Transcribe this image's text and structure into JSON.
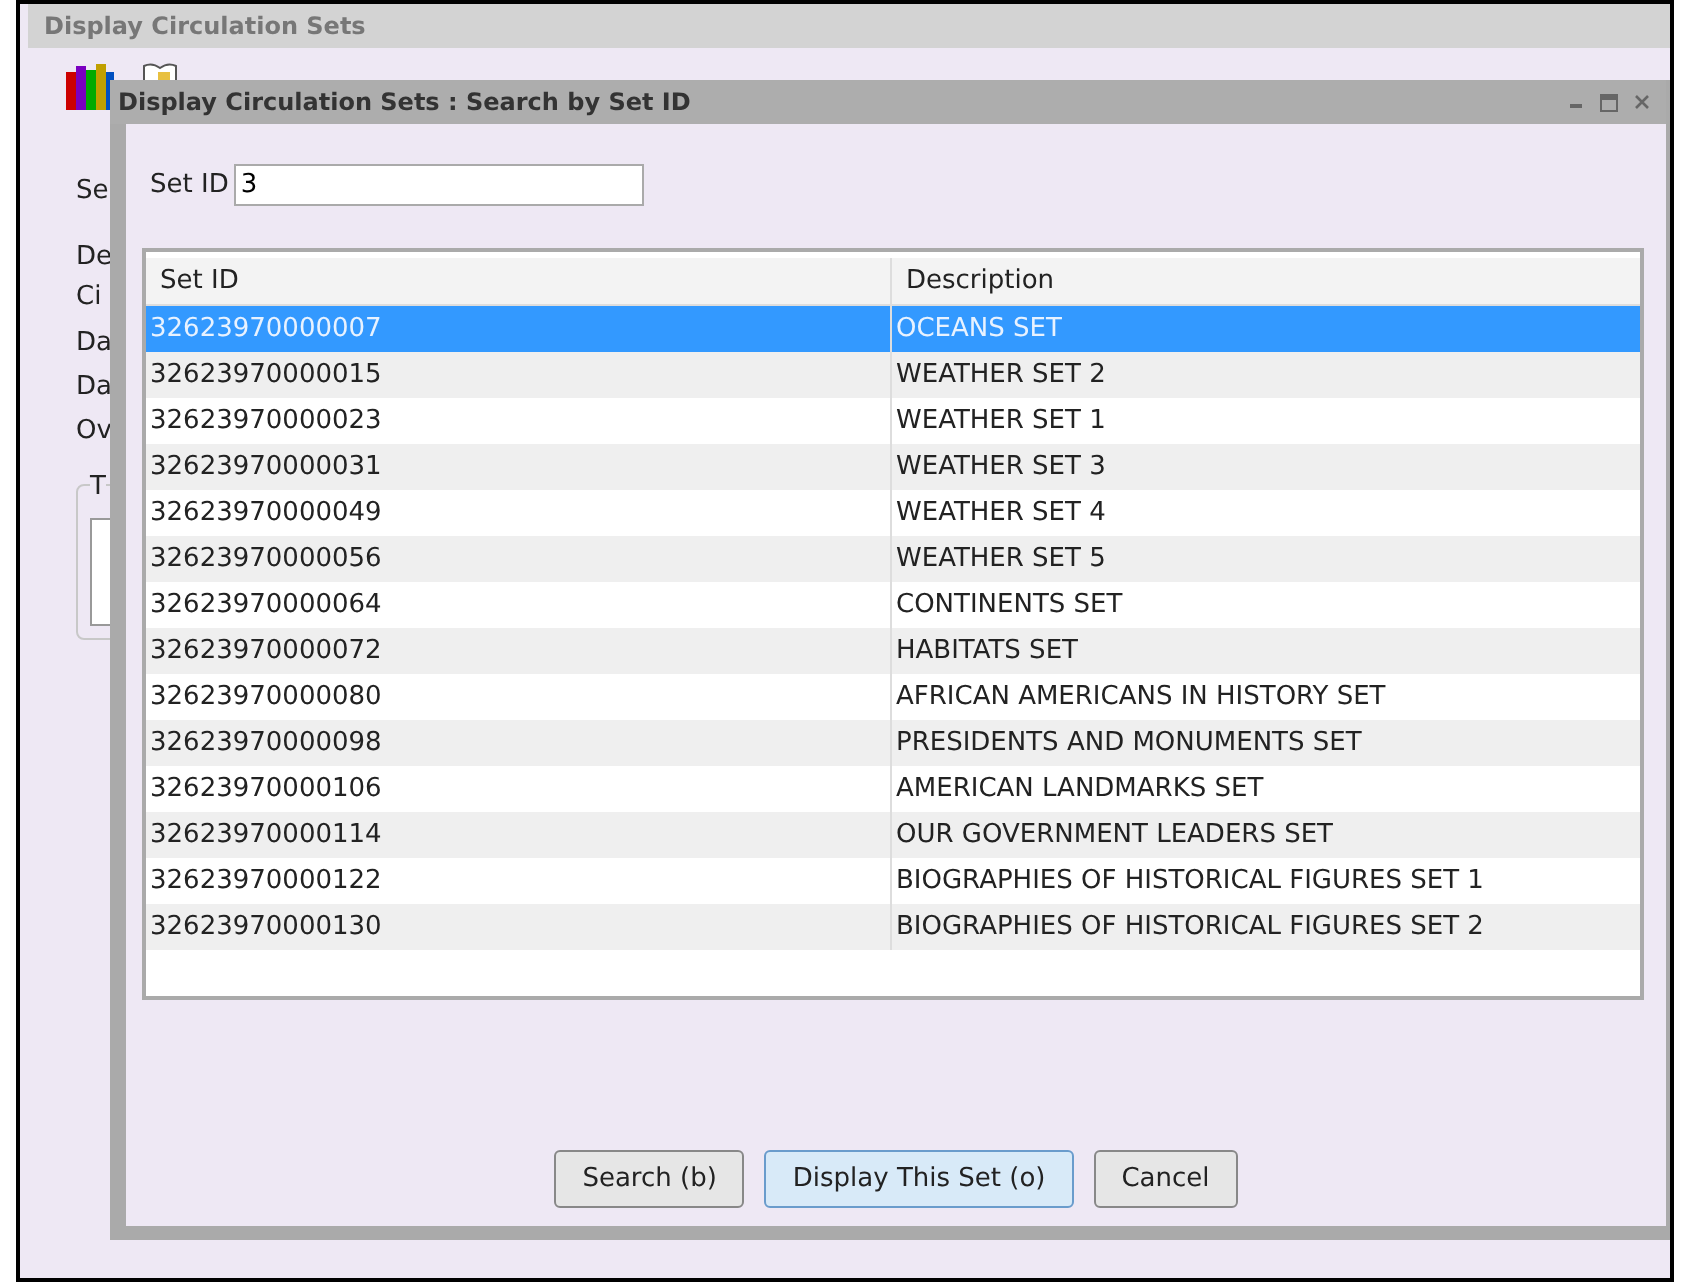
{
  "window": {
    "title": "Display Circulation Sets"
  },
  "background_labels": [
    "Se",
    "De",
    "Ci",
    "Da",
    "Da",
    "Ov"
  ],
  "background_group": {
    "label": "T"
  },
  "dialog": {
    "title": "Display Circulation Sets : Search by Set ID",
    "set_id_field": {
      "label": "Set ID",
      "value": "3"
    },
    "table": {
      "columns": [
        "Set ID",
        "Description"
      ],
      "rows": [
        {
          "set_id": "32623970000007",
          "description": "OCEANS SET",
          "selected": true
        },
        {
          "set_id": "32623970000015",
          "description": "WEATHER SET 2",
          "selected": false
        },
        {
          "set_id": "32623970000023",
          "description": "WEATHER SET 1",
          "selected": false
        },
        {
          "set_id": "32623970000031",
          "description": "WEATHER SET 3",
          "selected": false
        },
        {
          "set_id": "32623970000049",
          "description": "WEATHER SET 4",
          "selected": false
        },
        {
          "set_id": "32623970000056",
          "description": "WEATHER SET 5",
          "selected": false
        },
        {
          "set_id": "32623970000064",
          "description": "CONTINENTS SET",
          "selected": false
        },
        {
          "set_id": "32623970000072",
          "description": "HABITATS SET",
          "selected": false
        },
        {
          "set_id": "32623970000080",
          "description": "AFRICAN AMERICANS IN HISTORY SET",
          "selected": false
        },
        {
          "set_id": "32623970000098",
          "description": "PRESIDENTS AND MONUMENTS SET",
          "selected": false
        },
        {
          "set_id": "32623970000106",
          "description": "AMERICAN LANDMARKS SET",
          "selected": false
        },
        {
          "set_id": "32623970000114",
          "description": "OUR GOVERNMENT LEADERS SET",
          "selected": false
        },
        {
          "set_id": "32623970000122",
          "description": "BIOGRAPHIES OF HISTORICAL FIGURES SET 1",
          "selected": false
        },
        {
          "set_id": "32623970000130",
          "description": "BIOGRAPHIES OF HISTORICAL FIGURES SET 2",
          "selected": false
        }
      ]
    },
    "buttons": [
      {
        "label": "Search (b)",
        "kind": "normal"
      },
      {
        "label": "Display This Set (o)",
        "kind": "default"
      },
      {
        "label": "Cancel",
        "kind": "normal"
      }
    ]
  }
}
